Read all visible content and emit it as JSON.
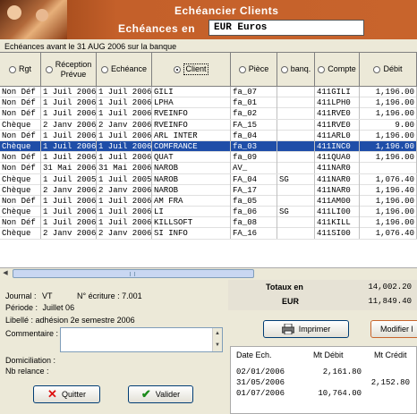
{
  "header": {
    "title": "Echéancier Clients",
    "subtitle": "Echéances en",
    "currency": "EUR Euros"
  },
  "caption": "Echéances avant le 31 AUG 2006 sur la banque",
  "grid": {
    "columns": [
      {
        "label": "Rgt",
        "radio": false
      },
      {
        "label": "Réception\nPrévue",
        "radio": false
      },
      {
        "label": "Echéance",
        "radio": false
      },
      {
        "label": "Client",
        "radio": true
      },
      {
        "label": "Pièce",
        "radio": false
      },
      {
        "label": "banq.",
        "radio": false
      },
      {
        "label": "Compte",
        "radio": false
      },
      {
        "label": "Débit",
        "radio": false
      }
    ],
    "rows": [
      [
        "Non Déf",
        "1 Juil 2006",
        "1 Juil 2006",
        "GILI",
        "fa_07",
        "",
        "411GILI",
        "1,196.00"
      ],
      [
        "Non Déf",
        "1 Juil 2006",
        "1 Juil 2006",
        "LPHA",
        "fa_01",
        "",
        "411LPH0",
        "1,196.00"
      ],
      [
        "Non Déf",
        "1 Juil 2006",
        "1 Juil 2006",
        "RVEINFO",
        "fa_02",
        "",
        "411RVE0",
        "1,196.00"
      ],
      [
        "Chèque",
        "2 Janv 2006",
        "2 Janv 2006",
        "RVEINFO",
        "FA_15",
        "",
        "411RVE0",
        "9.00"
      ],
      [
        "Non Déf",
        "1 Juil 2006",
        "1 Juil 2006",
        "ARL INTER",
        "fa_04",
        "",
        "411ARL0",
        "1,196.00"
      ],
      [
        "Chèque",
        "1 Juil 2006",
        "1 Juil 2006",
        "COMFRANCE",
        "fa_03",
        "",
        "411INC0",
        "1,196.00"
      ],
      [
        "Non Déf",
        "1 Juil 2006",
        "1 Juil 2006",
        "QUAT",
        "fa_09",
        "",
        "411QUA0",
        "1,196.00"
      ],
      [
        "Non Déf",
        "31 Mai 2006",
        "31 Mai 2006",
        "NAROB",
        "AV_",
        "",
        "411NAR0",
        ""
      ],
      [
        "Chèque",
        "1 Juil 2005",
        "1 Juil 2005",
        "NAROB",
        "FA_04",
        "SG",
        "411NAR0",
        "1,076.40"
      ],
      [
        "Chèque",
        "2 Janv 2006",
        "2 Janv 2006",
        "NAROB",
        "FA_17",
        "",
        "411NAR0",
        "1,196.40"
      ],
      [
        "Non Déf",
        "1 Juil 2006",
        "1 Juil 2006",
        "AM FRA",
        "fa_05",
        "",
        "411AM00",
        "1,196.00"
      ],
      [
        "Chèque",
        "1 Juil 2006",
        "1 Juil 2006",
        "LI",
        "fa_06",
        "SG",
        "411LI00",
        "1,196.00"
      ],
      [
        "Non Déf",
        "1 Juil 2006",
        "1 Juil 2006",
        "KILLSOFT",
        "fa_08",
        "",
        "411KILL",
        "1,196.00"
      ],
      [
        "Chèque",
        "2 Janv 2006",
        "2 Janv 2006",
        "SI INFO",
        "FA_16",
        "",
        "411SI00",
        "1,076.40"
      ]
    ],
    "selected_row": 5
  },
  "journal": {
    "journal_label": "Journal :",
    "journal_value": "VT",
    "ecriture_label": "N° écriture :",
    "ecriture_value": "7.001",
    "periode_label": "Période :",
    "periode_value": "Juillet 06",
    "libelle_label": "Libellé :",
    "libelle_value": "adhésion 2e semestre 2006",
    "commentaire_label": "Commentaire :",
    "domiciliation_label": "Domiciliation :",
    "relance_label": "Nb relance :"
  },
  "totals": {
    "label": "Totaux en",
    "currency": "EUR",
    "debit": "14,002.20",
    "credit": "11,849.40"
  },
  "buttons": {
    "print": "Imprimer",
    "modify": "Modifier l",
    "quit": "Quitter",
    "validate": "Valider"
  },
  "schedule": {
    "headers": [
      "Date Ech.",
      "Mt Débit",
      "Mt Crédit"
    ],
    "rows": [
      [
        "02/01/2006",
        "2,161.80",
        ""
      ],
      [
        "31/05/2006",
        "",
        "2,152.80"
      ],
      [
        "01/07/2006",
        "10,764.00",
        ""
      ]
    ]
  },
  "colors": {
    "header_bg": "#c4602a",
    "selection": "#1f4ea8"
  }
}
